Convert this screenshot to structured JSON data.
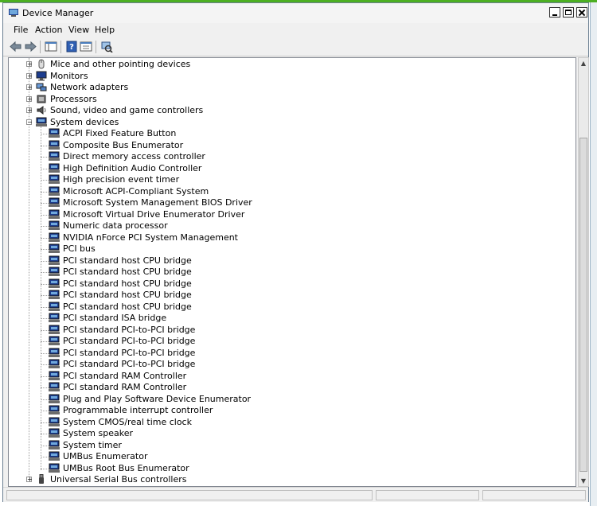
{
  "window": {
    "title": "Device Manager",
    "icon": "computer-management-icon"
  },
  "menu": [
    "File",
    "Action",
    "View",
    "Help"
  ],
  "toolbar": {
    "buttons": [
      "back-arrow-icon",
      "forward-arrow-icon",
      "show-hide-console-tree-icon",
      "help-icon",
      "properties-icon",
      "scan-hardware-changes-icon"
    ]
  },
  "tree": {
    "categories_before": [
      {
        "label": "Mice and other pointing devices",
        "icon": "mouse-icon",
        "expander": "+"
      },
      {
        "label": "Monitors",
        "icon": "monitor-icon",
        "expander": "+"
      },
      {
        "label": "Network adapters",
        "icon": "network-adapter-icon",
        "expander": "+"
      },
      {
        "label": "Processors",
        "icon": "processor-icon",
        "expander": "+"
      },
      {
        "label": "Sound, video and game controllers",
        "icon": "speaker-icon",
        "expander": "+"
      }
    ],
    "system_devices": {
      "label": "System devices",
      "icon": "system-device-icon",
      "expander": "-",
      "children": [
        "ACPI Fixed Feature Button",
        "Composite Bus Enumerator",
        "Direct memory access controller",
        "High Definition Audio Controller",
        "High precision event timer",
        "Microsoft ACPI-Compliant System",
        "Microsoft System Management BIOS Driver",
        "Microsoft Virtual Drive Enumerator Driver",
        "Numeric data processor",
        "NVIDIA nForce PCI System Management",
        "PCI bus",
        "PCI standard host CPU bridge",
        "PCI standard host CPU bridge",
        "PCI standard host CPU bridge",
        "PCI standard host CPU bridge",
        "PCI standard host CPU bridge",
        "PCI standard ISA bridge",
        "PCI standard PCI-to-PCI bridge",
        "PCI standard PCI-to-PCI bridge",
        "PCI standard PCI-to-PCI bridge",
        "PCI standard PCI-to-PCI bridge",
        "PCI standard RAM Controller",
        "PCI standard RAM Controller",
        "Plug and Play Software Device Enumerator",
        "Programmable interrupt controller",
        "System CMOS/real time clock",
        "System speaker",
        "System timer",
        "UMBus Enumerator",
        "UMBus Root Bus Enumerator"
      ]
    },
    "categories_after": [
      {
        "label": "Universal Serial Bus controllers",
        "icon": "usb-icon",
        "expander": "+"
      }
    ]
  },
  "colors": {
    "accent_green": "#4caf22",
    "device_icon_blue": "#1d3d8f"
  }
}
